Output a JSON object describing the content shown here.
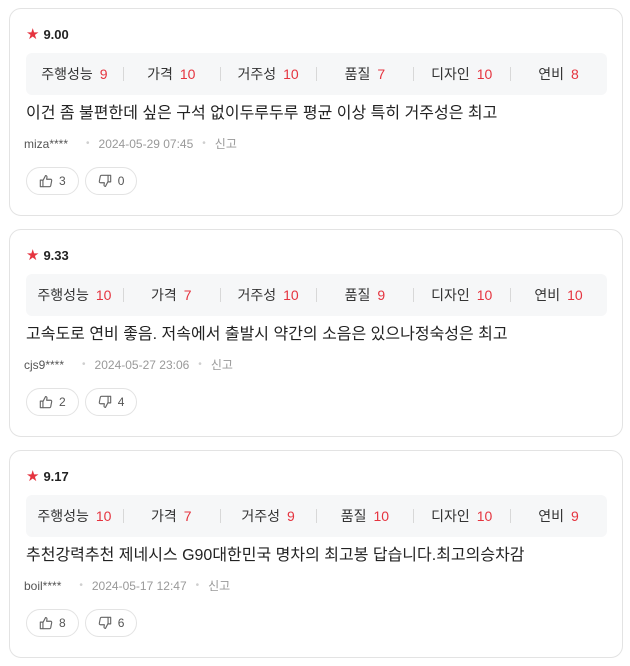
{
  "reviews": [
    {
      "score": "9.00",
      "metrics": [
        {
          "label": "주행성능",
          "value": "9"
        },
        {
          "label": "가격",
          "value": "10"
        },
        {
          "label": "거주성",
          "value": "10"
        },
        {
          "label": "품질",
          "value": "7"
        },
        {
          "label": "디자인",
          "value": "10"
        },
        {
          "label": "연비",
          "value": "8"
        }
      ],
      "text": "이건 좀 불편한데 싶은 구석 없이두루두루 평균 이상 특히 거주성은 최고",
      "user": "miza****",
      "date": "2024-05-29 07:45",
      "report": "신고",
      "likes": "3",
      "dislikes": "0"
    },
    {
      "score": "9.33",
      "metrics": [
        {
          "label": "주행성능",
          "value": "10"
        },
        {
          "label": "가격",
          "value": "7"
        },
        {
          "label": "거주성",
          "value": "10"
        },
        {
          "label": "품질",
          "value": "9"
        },
        {
          "label": "디자인",
          "value": "10"
        },
        {
          "label": "연비",
          "value": "10"
        }
      ],
      "text": "고속도로 연비 좋음. 저속에서 출발시 약간의 소음은 있으나정숙성은 최고",
      "user": "cjs9****",
      "date": "2024-05-27 23:06",
      "report": "신고",
      "likes": "2",
      "dislikes": "4"
    },
    {
      "score": "9.17",
      "metrics": [
        {
          "label": "주행성능",
          "value": "10"
        },
        {
          "label": "가격",
          "value": "7"
        },
        {
          "label": "거주성",
          "value": "9"
        },
        {
          "label": "품질",
          "value": "10"
        },
        {
          "label": "디자인",
          "value": "10"
        },
        {
          "label": "연비",
          "value": "9"
        }
      ],
      "text": "추천강력추천 제네시스 G90대한민국 명차의 최고봉 답습니다.최고의승차감",
      "user": "boil****",
      "date": "2024-05-17 12:47",
      "report": "신고",
      "likes": "8",
      "dislikes": "6"
    }
  ],
  "colors": {
    "accent": "#e5343f",
    "metrics_bg": "#f6f7f8",
    "border": "#e3e3e3"
  },
  "icons": {
    "rating": "star-icon",
    "like": "thumbs-up-icon",
    "dislike": "thumbs-down-icon"
  }
}
